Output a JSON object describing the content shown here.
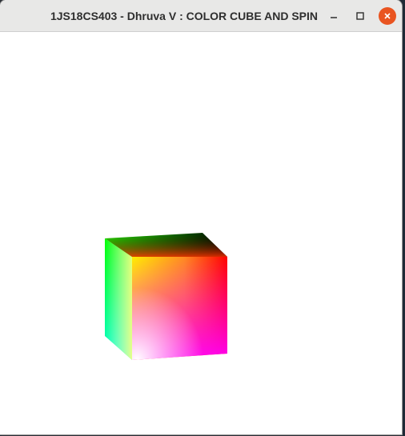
{
  "window": {
    "title": "1JS18CS403 - Dhruva V : COLOR CUBE AND SPIN",
    "controls": {
      "minimize_icon": "minimize-icon",
      "maximize_icon": "maximize-icon",
      "close_icon": "close-icon",
      "close_color": "#e95420"
    }
  },
  "scene": {
    "object": "color-cube",
    "background": "#ffffff",
    "face_colors": {
      "top": [
        "#00ff00",
        "#000000",
        "#ff0000",
        "#ffff00"
      ],
      "front": [
        "#ffff00",
        "#ff0000",
        "#ff00ff",
        "#ffffff"
      ],
      "left": [
        "#00ff00",
        "#ffff00",
        "#ffffff",
        "#00ffff"
      ]
    }
  }
}
